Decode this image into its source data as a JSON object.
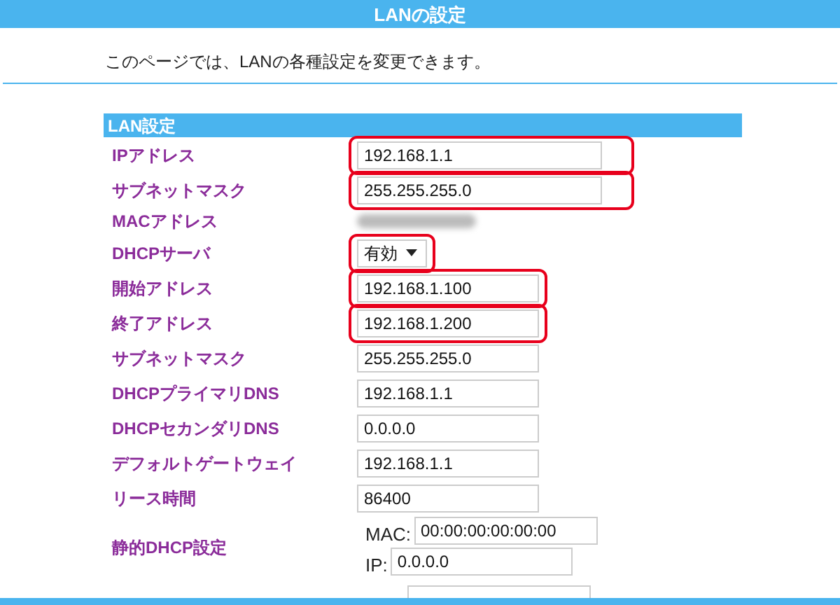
{
  "header": {
    "title": "LANの設定"
  },
  "intro": "このページでは、LANの各種設定を変更できます。",
  "section": {
    "title": "LAN設定",
    "rows": [
      {
        "label": "IPアドレス",
        "kind": "text",
        "value": "192.168.1.1",
        "highlighted": true,
        "wide": true
      },
      {
        "label": "サブネットマスク",
        "kind": "text",
        "value": "255.255.255.0",
        "highlighted": true,
        "wide": true
      },
      {
        "label": "MACアドレス",
        "kind": "blurred"
      },
      {
        "label": "DHCPサーバ",
        "kind": "select",
        "value": "有効",
        "highlighted": true
      },
      {
        "label": "開始アドレス",
        "kind": "text",
        "value": "192.168.1.100",
        "highlighted": true,
        "wide": false
      },
      {
        "label": "終了アドレス",
        "kind": "text",
        "value": "192.168.1.200",
        "highlighted": true,
        "wide": false
      },
      {
        "label": "サブネットマスク",
        "kind": "text",
        "value": "255.255.255.0",
        "highlighted": false,
        "wide": false
      },
      {
        "label": "DHCPプライマリDNS",
        "kind": "text",
        "value": "192.168.1.1",
        "highlighted": false,
        "wide": false
      },
      {
        "label": "DHCPセカンダリDNS",
        "kind": "text",
        "value": "0.0.0.0",
        "highlighted": false,
        "wide": false
      },
      {
        "label": "デフォルトゲートウェイ",
        "kind": "text",
        "value": "192.168.1.1",
        "highlighted": false,
        "wide": false
      },
      {
        "label": "リース時間",
        "kind": "text",
        "value": "86400",
        "highlighted": false,
        "wide": false
      },
      {
        "label": "静的DHCP設定",
        "kind": "static",
        "entries": [
          {
            "mac_label": "MAC:",
            "mac": "00:00:00:00:00:00",
            "ip_label": "IP:",
            "ip": "0.0.0.0"
          }
        ]
      }
    ]
  }
}
